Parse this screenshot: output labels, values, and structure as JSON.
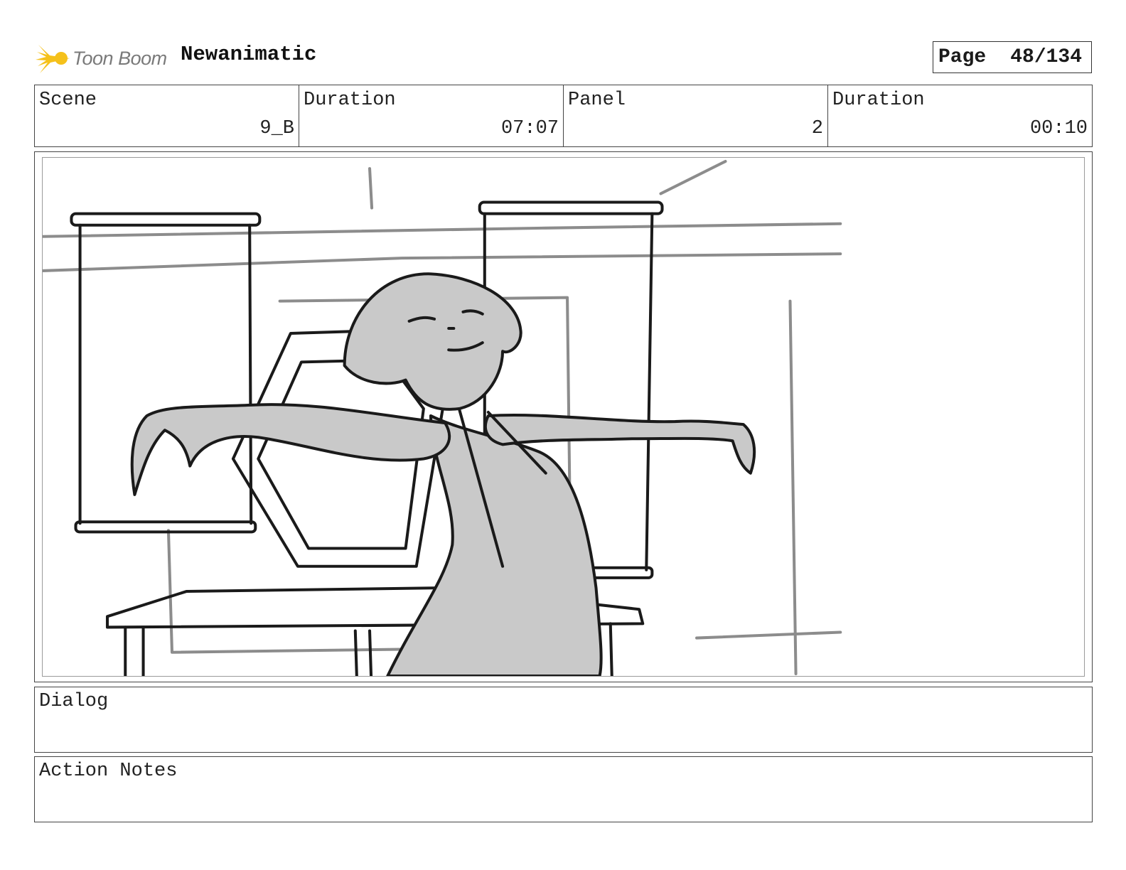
{
  "header": {
    "logo_text": "Toon Boom",
    "project_title": "Newanimatic",
    "page_label": "Page",
    "page_number": "48/134"
  },
  "info": {
    "scene_label": "Scene",
    "scene_value": "9_B",
    "scene_duration_label": "Duration",
    "scene_duration_value": "07:07",
    "panel_label": "Panel",
    "panel_value": "2",
    "panel_duration_label": "Duration",
    "panel_duration_value": "00:10"
  },
  "dialog": {
    "label": "Dialog",
    "text": ""
  },
  "notes": {
    "label": "Action Notes",
    "text": ""
  },
  "colors": {
    "logo_yellow": "#f5c11b",
    "sketch_grey": "#c9c9c9",
    "line_dark": "#1a1a1a",
    "line_grey": "#8c8c8c"
  },
  "icons": {
    "logo": "toon-boom-burst-icon"
  }
}
